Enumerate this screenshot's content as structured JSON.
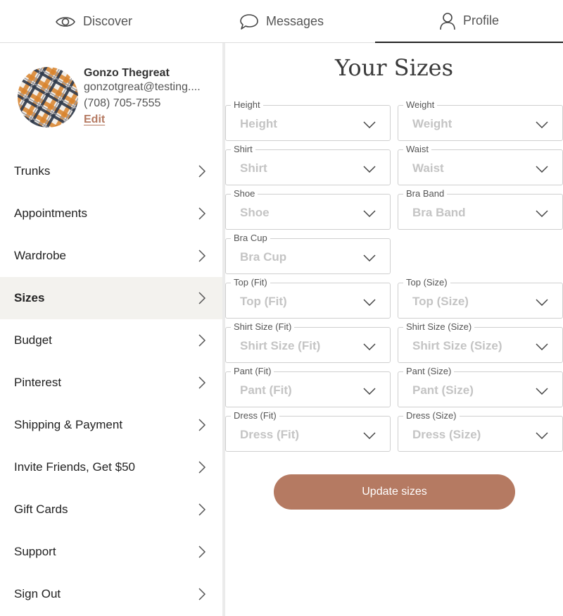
{
  "tabs": [
    {
      "label": "Discover",
      "icon": "eye-icon"
    },
    {
      "label": "Messages",
      "icon": "chat-bubble-icon"
    },
    {
      "label": "Profile",
      "icon": "person-icon",
      "active": true
    }
  ],
  "profile": {
    "name": "Gonzo Thegreat",
    "email": "gonzotgreat@testing....",
    "phone": "(708) 705-7555",
    "edit_label": "Edit"
  },
  "menu": [
    {
      "label": "Trunks"
    },
    {
      "label": "Appointments"
    },
    {
      "label": "Wardrobe"
    },
    {
      "label": "Sizes",
      "active": true
    },
    {
      "label": "Budget"
    },
    {
      "label": "Pinterest"
    },
    {
      "label": "Shipping & Payment"
    },
    {
      "label": "Invite Friends, Get $50"
    },
    {
      "label": "Gift Cards"
    },
    {
      "label": "Support"
    },
    {
      "label": "Sign Out"
    }
  ],
  "main": {
    "title": "Your Sizes",
    "fields": [
      {
        "label": "Height",
        "placeholder": "Height"
      },
      {
        "label": "Weight",
        "placeholder": "Weight"
      },
      {
        "label": "Shirt",
        "placeholder": "Shirt"
      },
      {
        "label": "Waist",
        "placeholder": "Waist"
      },
      {
        "label": "Shoe",
        "placeholder": "Shoe"
      },
      {
        "label": "Bra Band",
        "placeholder": "Bra Band"
      },
      {
        "label": "Bra Cup",
        "placeholder": "Bra Cup"
      },
      {
        "label": "Top (Fit)",
        "placeholder": "Top (Fit)"
      },
      {
        "label": "Top (Size)",
        "placeholder": "Top (Size)"
      },
      {
        "label": "Shirt Size (Fit)",
        "placeholder": "Shirt Size (Fit)"
      },
      {
        "label": "Shirt Size (Size)",
        "placeholder": "Shirt Size (Size)"
      },
      {
        "label": "Pant (Fit)",
        "placeholder": "Pant (Fit)"
      },
      {
        "label": "Pant (Size)",
        "placeholder": "Pant (Size)"
      },
      {
        "label": "Dress (Fit)",
        "placeholder": "Dress (Fit)"
      },
      {
        "label": "Dress (Size)",
        "placeholder": "Dress (Size)"
      }
    ],
    "submit_label": "Update sizes"
  },
  "colors": {
    "accent": "#b57a62",
    "active_row": "#f3f2ee"
  }
}
